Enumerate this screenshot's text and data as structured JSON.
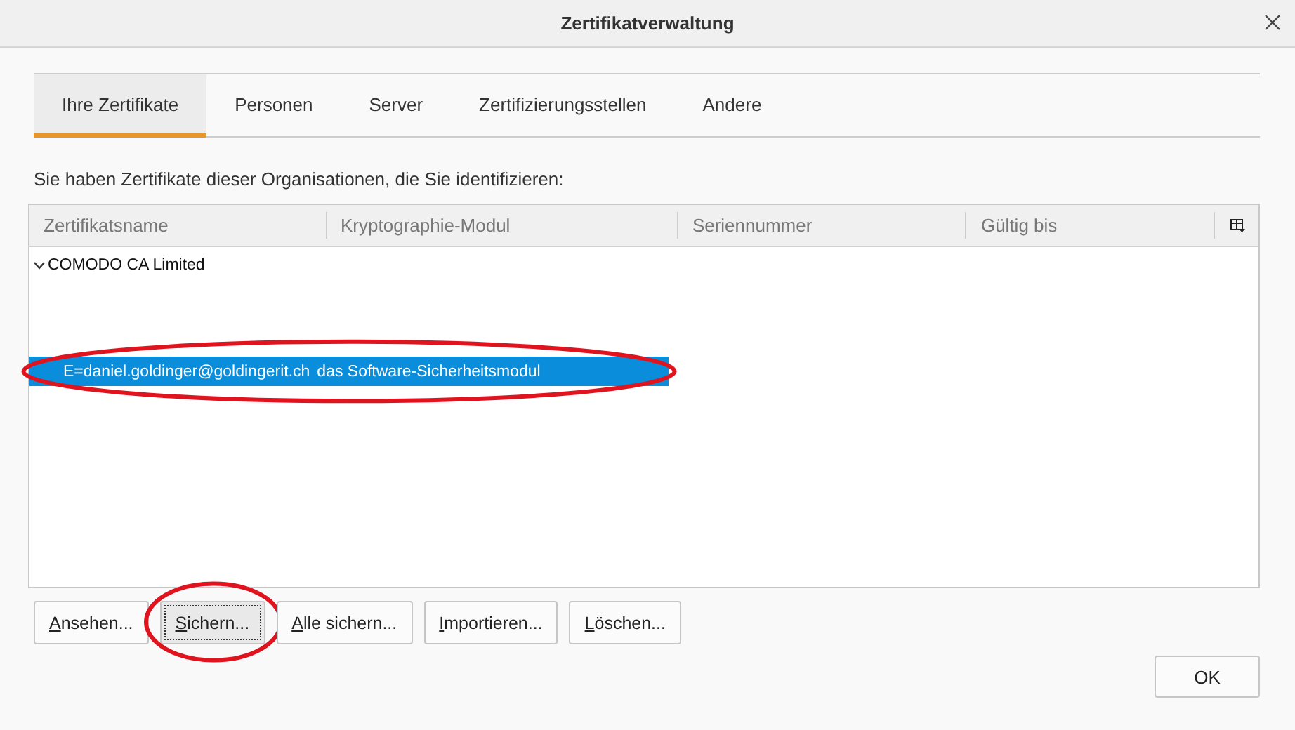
{
  "window": {
    "title": "Zertifikatverwaltung"
  },
  "tabs": [
    {
      "label": "Ihre Zertifikate",
      "selected": true
    },
    {
      "label": "Personen",
      "selected": false
    },
    {
      "label": "Server",
      "selected": false
    },
    {
      "label": "Zertifizierungsstellen",
      "selected": false
    },
    {
      "label": "Andere",
      "selected": false
    }
  ],
  "description": "Sie haben Zertifikate dieser Organisationen, die Sie identifizieren:",
  "table": {
    "columns": [
      "Zertifikatsname",
      "Kryptographie-Modul",
      "Seriennummer",
      "Gültig bis"
    ],
    "rows": [
      {
        "name": "COMODO CA Limited",
        "expanded": true,
        "children": [
          {
            "cells": [
              "E=daniel.goldinger@goldingerit.ch",
              "das Software-Sicherheitsmodul"
            ],
            "selected": true,
            "marked": true
          }
        ]
      }
    ]
  },
  "buttons": [
    {
      "label": "Ansehen...",
      "focused": false,
      "marked": false
    },
    {
      "label": "Sichern...",
      "focused": true,
      "marked": true
    },
    {
      "label": "Alle sichern...",
      "focused": false,
      "marked": false
    },
    {
      "label": "Importieren...",
      "focused": false,
      "marked": false
    },
    {
      "label": "Löschen...",
      "focused": false,
      "marked": false
    }
  ],
  "ok_button": "OK"
}
